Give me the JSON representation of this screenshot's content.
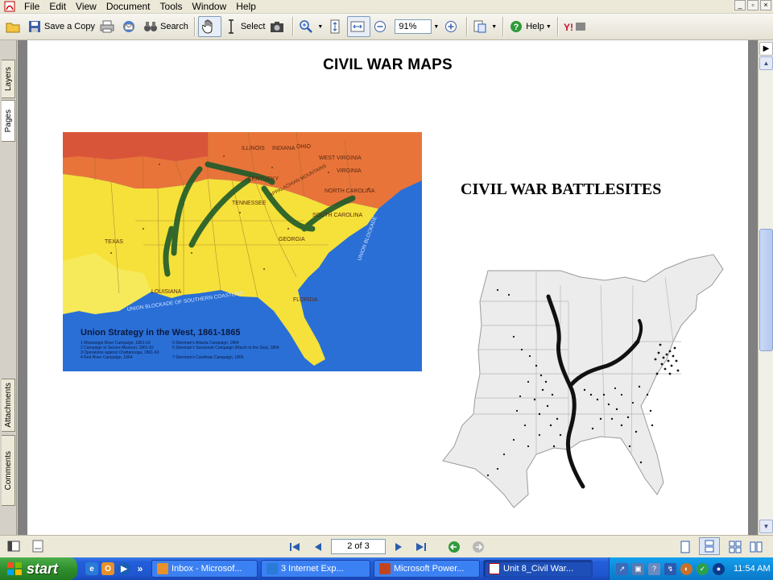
{
  "menu": {
    "items": [
      "File",
      "Edit",
      "View",
      "Document",
      "Tools",
      "Window",
      "Help"
    ]
  },
  "toolbar": {
    "save_copy_label": "Save a Copy",
    "search_label": "Search",
    "select_label": "Select",
    "zoom_value": "91%",
    "help_label": "Help"
  },
  "nav_tabs": {
    "layers": "Layers",
    "pages": "Pages",
    "attachments": "Attachments",
    "comments": "Comments"
  },
  "document": {
    "page_title": "CIVIL WAR MAPS",
    "map1": {
      "title": "Union Strategy in the West, 1861-1865",
      "legend_left": [
        "1 Mississippi River Campaign, 1861-63",
        "2 Campaign to Secure Missouri, 1861-62",
        "3 Operations against Chattanooga, 1861-63",
        "4 Red River Campaign, 1864"
      ],
      "legend_right": [
        "5 Sherman's Atlanta Campaign, 1864",
        "6 Sherman's Savannah Campaign (March to the Sea), 1864",
        "7 Sherman's Carolinas Campaign, 1865"
      ],
      "labels": {
        "texas": "TEXAS",
        "louisiana": "LOUISIANA",
        "georgia": "GEORGIA",
        "florida": "FLORIDA",
        "tennessee": "TENNESSEE",
        "kentucky": "KENTUCKY",
        "virginia": "VIRGINIA",
        "north_carolina": "NORTH CAROLINA",
        "south_carolina": "SOUTH CAROLINA",
        "ohio": "OHIO",
        "indiana": "INDIANA",
        "illinois": "ILLINOIS",
        "west_virginia": "WEST VIRGINIA",
        "blockade_south": "UNION BLOCKADE OF SOUTHERN COASTLINE",
        "blockade_east": "UNION BLOCKADE",
        "appalachian": "APPALACHIAN MOUNTAINS"
      }
    },
    "map2_title": "CIVIL WAR BATTLESITES"
  },
  "statusbar": {
    "page_indicator": "2 of 3"
  },
  "taskbar": {
    "start_label": "start",
    "tasks": [
      "Inbox - Microsof...",
      "3 Internet Exp...",
      "Microsoft Power...",
      "Unit 8_Civil War..."
    ],
    "clock": "11:54 AM"
  },
  "colors": {
    "taskbar_blue": "#245edb",
    "start_green": "#2f8f2d",
    "map_ocean": "#2a6fd6",
    "map_confederate": "#f5e13a",
    "map_union": "#e8743a"
  }
}
